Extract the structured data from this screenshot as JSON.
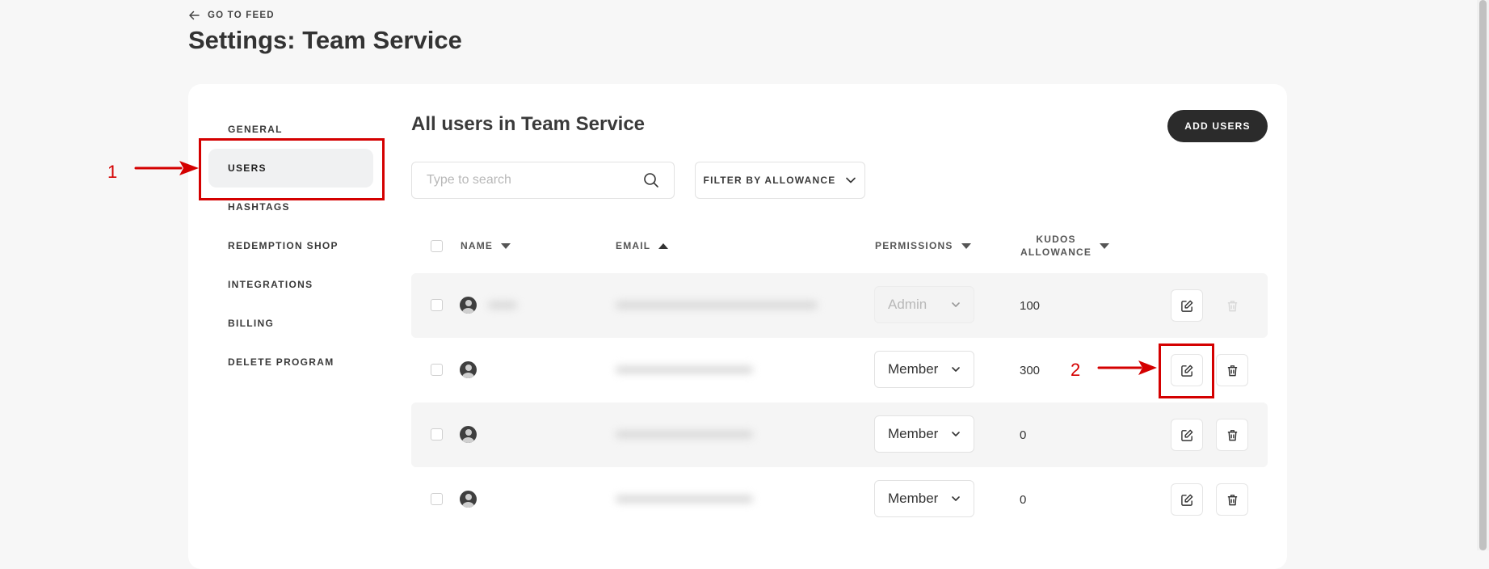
{
  "header": {
    "back_label": "GO TO FEED",
    "title": "Settings: Team Service"
  },
  "sidebar": {
    "items": [
      {
        "label": "GENERAL"
      },
      {
        "label": "USERS",
        "active": true
      },
      {
        "label": "HASHTAGS"
      },
      {
        "label": "REDEMPTION SHOP"
      },
      {
        "label": "INTEGRATIONS"
      },
      {
        "label": "BILLING"
      },
      {
        "label": "DELETE PROGRAM"
      }
    ]
  },
  "main": {
    "title": "All users in Team Service",
    "add_button": "ADD USERS",
    "search": {
      "placeholder": "Type to search",
      "value": ""
    },
    "filter_label": "FILTER BY ALLOWANCE",
    "columns": {
      "name": "NAME",
      "email": "EMAIL",
      "permissions": "PERMISSIONS",
      "kudos_line1": "KUDOS",
      "kudos_line2": "ALLOWANCE"
    },
    "rows": [
      {
        "permission": "Admin",
        "allowance": "100",
        "permission_disabled": true,
        "delete_disabled": true
      },
      {
        "permission": "Member",
        "allowance": "300",
        "permission_disabled": false,
        "delete_disabled": false
      },
      {
        "permission": "Member",
        "allowance": "0",
        "permission_disabled": false,
        "delete_disabled": false
      },
      {
        "permission": "Member",
        "allowance": "0",
        "permission_disabled": false,
        "delete_disabled": false
      }
    ]
  },
  "annotations": {
    "label_1": "1",
    "label_2": "2",
    "color": "#d40000"
  },
  "icons": {
    "back": "arrow-left-icon",
    "search": "search-icon",
    "filter": "chevron-down-icon",
    "edit": "edit-icon",
    "delete": "trash-icon",
    "avatar": "user-avatar-icon"
  }
}
